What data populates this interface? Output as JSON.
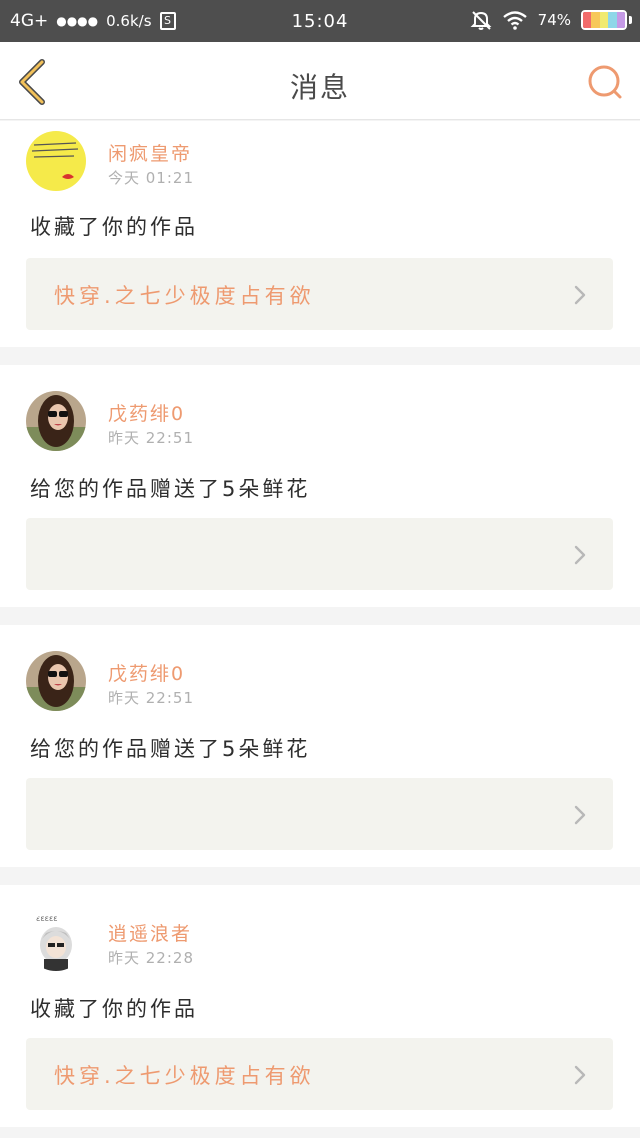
{
  "status_bar": {
    "network": "4G+",
    "signal_dots": "●●●●",
    "speed": "0.6k/s",
    "sim_label": "S",
    "time": "15:04",
    "battery": "74%",
    "battery_colors": [
      "#f26b6b",
      "#f7c85a",
      "#f1ea6f",
      "#8ed7e8",
      "#c59ae6"
    ]
  },
  "header": {
    "title": "消息",
    "back_icon": "chevron-left-icon",
    "search_icon": "search-icon",
    "accent_color": "#ee9a70",
    "back_color": "#f2c15a"
  },
  "messages": [
    {
      "name": "闲疯皇帝",
      "time": "今天 01:21",
      "action": "收藏了你的作品",
      "work_title": "快穿.之七少极度占有欲",
      "avatar": "yellow-note-avatar"
    },
    {
      "name": "戊药绯0",
      "time": "昨天 22:51",
      "action": "给您的作品赠送了5朵鲜花",
      "work_title": "",
      "avatar": "sunglasses-girl-avatar"
    },
    {
      "name": "戊药绯0",
      "time": "昨天 22:51",
      "action": "给您的作品赠送了5朵鲜花",
      "work_title": "",
      "avatar": "sunglasses-girl-avatar"
    },
    {
      "name": "逍遥浪者",
      "time": "昨天 22:28",
      "action": "收藏了你的作品",
      "work_title": "快穿.之七少极度占有欲",
      "avatar": "cartoon-boy-avatar"
    }
  ]
}
